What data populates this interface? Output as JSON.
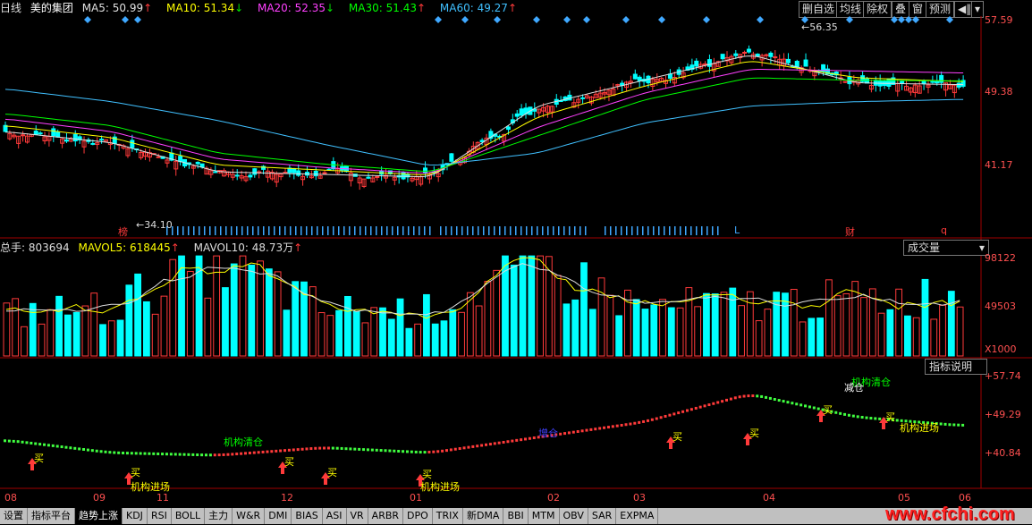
{
  "header": {
    "period": "日线",
    "stock": "美的集团",
    "ma5": {
      "label": "MA5:",
      "value": "50.99",
      "arrow": "↑",
      "color": "#e0e0e0"
    },
    "ma10": {
      "label": "MA10:",
      "value": "51.34",
      "arrow": "↓",
      "color": "#ffff00"
    },
    "ma20": {
      "label": "MA20:",
      "value": "52.35",
      "arrow": "↓",
      "color": "#ff40ff"
    },
    "ma30": {
      "label": "MA30:",
      "value": "51.43",
      "arrow": "↑",
      "color": "#00ff00"
    },
    "ma60": {
      "label": "MA60:",
      "value": "49.27",
      "arrow": "↑",
      "color": "#40c0ff"
    }
  },
  "toolbar": {
    "del": "删自选",
    "avg": "均线",
    "exrights": "除权",
    "overlay": "叠",
    "window": "窗",
    "forecast": "预测",
    "back": "◀‖",
    "menu": "▾"
  },
  "main_axis": [
    "57.59",
    "49.38",
    "41.17"
  ],
  "main_markers": {
    "hi": "56.35",
    "lo": "34.10",
    "bang": "榜",
    "cai": "财",
    "q": "q",
    "l": "L"
  },
  "volume": {
    "total_label": "总手:",
    "total_value": "803694",
    "mavol5_label": "MAVOL5:",
    "mavol5_value": "618445",
    "mavol10_label": "MAVOL10:",
    "mavol10_value": "48.73万",
    "selector": "成交量",
    "axis": [
      "98122",
      "49503"
    ],
    "unit": "X1000"
  },
  "indicator": {
    "explain": "指标说明",
    "axis": [
      "+57.74",
      "+49.29",
      "+40.84"
    ],
    "labels": {
      "buy": "买",
      "in": "机构进场",
      "clear": "机构清仓",
      "reduce": "减仓",
      "add": "增仓"
    }
  },
  "x_labels": [
    "08",
    "09",
    "11",
    "12",
    "01",
    "02",
    "03",
    "04",
    "05",
    "06"
  ],
  "bottom_tabs": [
    "设置",
    "指标平台",
    "趋势上涨",
    "KDJ",
    "RSI",
    "BOLL",
    "主力",
    "W&R",
    "DMI",
    "BIAS",
    "ASI",
    "VR",
    "ARBR",
    "DPO",
    "TRIX",
    "新DMA",
    "BBI",
    "MTM",
    "OBV",
    "SAR",
    "EXPMA"
  ],
  "watermark": "www.cfchi.com",
  "colors": {
    "up": "#ff3a3a",
    "down": "#00ffff",
    "ma5": "#e0e0e0",
    "ma10": "#ffff00",
    "ma20": "#ff40ff",
    "ma30": "#00ff00",
    "ma60": "#40c0ff",
    "diamond": "#3fa8ff"
  },
  "chart_data": {
    "type": "line",
    "title": "美的集团 日线",
    "x": [
      "08",
      "09",
      "11",
      "12",
      "01",
      "02",
      "03",
      "04",
      "05",
      "06"
    ],
    "price_ylim": [
      34.1,
      57.59
    ],
    "series": [
      {
        "name": "MA5",
        "values": [
          45.5,
          44.2,
          40.8,
          40.5,
          40.2,
          48.5,
          51.5,
          54.5,
          51.2,
          50.99
        ]
      },
      {
        "name": "MA10",
        "values": [
          46.2,
          44.8,
          41.6,
          41.0,
          40.4,
          47.2,
          50.8,
          53.8,
          51.8,
          51.34
        ]
      },
      {
        "name": "MA20",
        "values": [
          47.0,
          45.5,
          42.3,
          41.3,
          40.6,
          46.0,
          50.0,
          52.8,
          52.6,
          52.35
        ]
      },
      {
        "name": "MA30",
        "values": [
          47.6,
          46.2,
          43.0,
          41.7,
          40.8,
          45.0,
          49.2,
          51.8,
          51.5,
          51.43
        ]
      },
      {
        "name": "MA60",
        "values": [
          50.5,
          49.0,
          46.8,
          44.0,
          41.5,
          43.0,
          46.5,
          48.5,
          49.0,
          49.27
        ]
      }
    ],
    "volume_ylim": [
      0,
      98122
    ],
    "volume": [
      42000,
      48000,
      98000,
      45000,
      44000,
      90000,
      47000,
      52000,
      55000,
      60000
    ],
    "indicator_ylim": [
      40.84,
      57.74
    ],
    "indicator": [
      46.5,
      44.0,
      43.5,
      45.0,
      44.0,
      47.0,
      50.0,
      55.5,
      51.0,
      49.29
    ]
  }
}
